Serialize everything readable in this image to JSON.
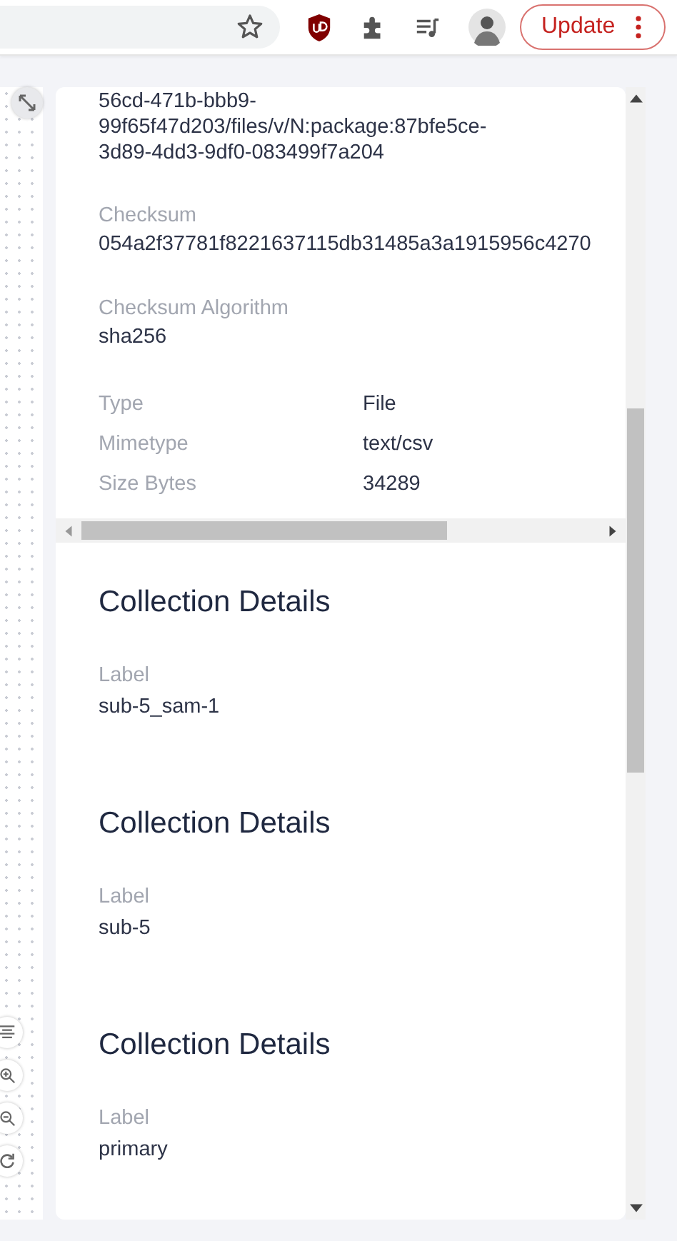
{
  "browser_toolbar": {
    "update_button": "Update"
  },
  "file_details": {
    "url_lines": [
      "56cd-471b-bbb9-",
      "99f65f47d203/files/v/N:package:87bfe5ce-",
      "3d89-4dd3-9df0-083499f7a204"
    ],
    "fields": [
      {
        "label": "Checksum",
        "value": "054a2f37781f8221637115db31485a3a1915956c4270"
      },
      {
        "label": "Checksum Algorithm",
        "value": "sha256"
      }
    ],
    "properties": [
      {
        "label": "Type",
        "value": "File"
      },
      {
        "label": "Mimetype",
        "value": "text/csv"
      },
      {
        "label": "Size Bytes",
        "value": "34289"
      }
    ]
  },
  "collections": [
    {
      "title": "Collection Details",
      "label": "Label",
      "value": "sub-5_sam-1"
    },
    {
      "title": "Collection Details",
      "label": "Label",
      "value": "sub-5"
    },
    {
      "title": "Collection Details",
      "label": "Label",
      "value": "primary"
    }
  ]
}
